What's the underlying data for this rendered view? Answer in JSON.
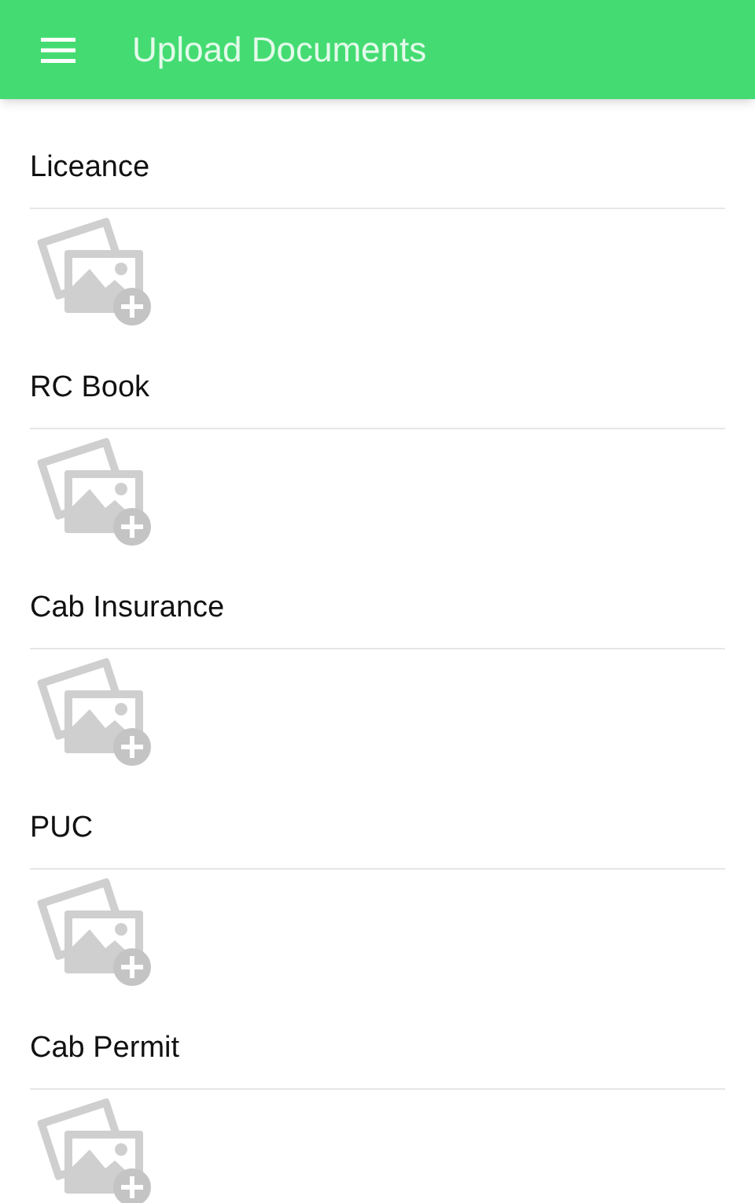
{
  "app_bar": {
    "title": "Upload Documents"
  },
  "documents": [
    {
      "label": "Liceance"
    },
    {
      "label": "RC Book"
    },
    {
      "label": "Cab Insurance"
    },
    {
      "label": "PUC"
    },
    {
      "label": "Cab Permit"
    }
  ]
}
